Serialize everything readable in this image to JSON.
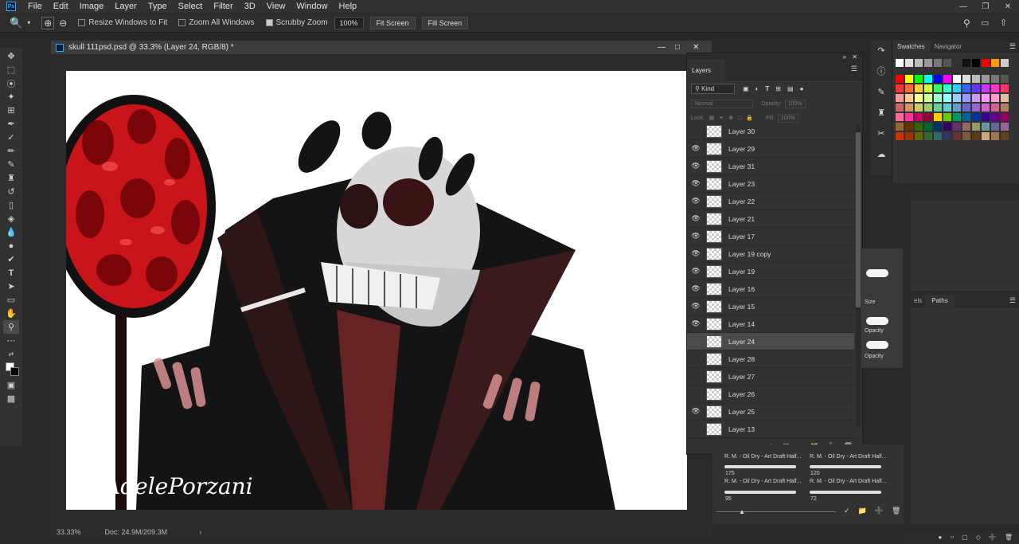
{
  "menubar": {
    "logo": "Ps",
    "items": [
      "File",
      "Edit",
      "Image",
      "Layer",
      "Type",
      "Select",
      "Filter",
      "3D",
      "View",
      "Window",
      "Help"
    ]
  },
  "options": {
    "resize_windows_label": "Resize Windows to Fit",
    "zoom_all_label": "Zoom All Windows",
    "scrubby_zoom_label": "Scrubby Zoom",
    "zoom_value": "100%",
    "fit_screen_label": "Fit Screen",
    "fill_screen_label": "Fill Screen"
  },
  "document": {
    "title": "skull 111psd.psd @ 33.3% (Layer 24, RGB/8) *",
    "zoom": "33.33%",
    "doc_size": "Doc: 24.9M/209.3M",
    "signature": "AdelePorzani"
  },
  "layers_panel": {
    "tab": "Layers",
    "kind_label": "Kind",
    "blend_mode": "Normal",
    "opacity_label": "Opacity:",
    "opacity_value": "100%",
    "lock_label": "Lock:",
    "fill_label": "Fill:",
    "fill_value": "100%",
    "layers": [
      {
        "name": "Layer 30",
        "visible": false,
        "selected": false
      },
      {
        "name": "Layer 29",
        "visible": true,
        "selected": false
      },
      {
        "name": "Layer 31",
        "visible": true,
        "selected": false
      },
      {
        "name": "Layer 23",
        "visible": true,
        "selected": false
      },
      {
        "name": "Layer 22",
        "visible": true,
        "selected": false
      },
      {
        "name": "Layer 21",
        "visible": true,
        "selected": false
      },
      {
        "name": "Layer 17",
        "visible": true,
        "selected": false
      },
      {
        "name": "Layer 19 copy",
        "visible": true,
        "selected": false
      },
      {
        "name": "Layer 19",
        "visible": true,
        "selected": false
      },
      {
        "name": "Layer 16",
        "visible": true,
        "selected": false
      },
      {
        "name": "Layer 15",
        "visible": true,
        "selected": false
      },
      {
        "name": "Layer 14",
        "visible": true,
        "selected": false
      },
      {
        "name": "Layer 24",
        "visible": false,
        "selected": true
      },
      {
        "name": "Layer 28",
        "visible": false,
        "selected": false
      },
      {
        "name": "Layer 27",
        "visible": false,
        "selected": false
      },
      {
        "name": "Layer 26",
        "visible": false,
        "selected": false
      },
      {
        "name": "Layer 25",
        "visible": true,
        "selected": false
      },
      {
        "name": "Layer 13",
        "visible": false,
        "selected": false
      }
    ]
  },
  "swatches_panel": {
    "tabs": [
      "Swatches",
      "Navigator"
    ],
    "grays": [
      "#ffffff",
      "#e0e0e0",
      "#bdbdbd",
      "#9a9a9a",
      "#777777",
      "#555555",
      "#333333",
      "#111111",
      "#000000",
      "#ff0000",
      "#ff9900",
      "#cccccc"
    ],
    "colors": [
      "#ff0000",
      "#ffff00",
      "#00ff00",
      "#00ffff",
      "#0000ff",
      "#ff00ff",
      "#ffffff",
      "#dddddd",
      "#bbbbbb",
      "#999999",
      "#777777",
      "#555555",
      "#ff3333",
      "#ff6633",
      "#ffcc33",
      "#ccff33",
      "#33ff66",
      "#33ffcc",
      "#33ccff",
      "#3366ff",
      "#6633ff",
      "#cc33ff",
      "#ff33cc",
      "#ff3366",
      "#ff9999",
      "#ffcc99",
      "#ffff99",
      "#ccff99",
      "#99ffcc",
      "#99ffff",
      "#99ccff",
      "#9999ff",
      "#cc99ff",
      "#ff99ff",
      "#ff99cc",
      "#e0c0a0",
      "#cc6666",
      "#cc9966",
      "#cccc66",
      "#99cc66",
      "#66cc99",
      "#66cccc",
      "#6699cc",
      "#6666cc",
      "#9966cc",
      "#cc66cc",
      "#cc6699",
      "#b08060",
      "#ff6699",
      "#ff3399",
      "#cc0066",
      "#990033",
      "#ffcc00",
      "#66cc00",
      "#009966",
      "#006699",
      "#003399",
      "#330099",
      "#660099",
      "#990066",
      "#996633",
      "#663300",
      "#336600",
      "#006633",
      "#003366",
      "#330066",
      "#663366",
      "#996666",
      "#999966",
      "#669999",
      "#666699",
      "#996699",
      "#cc3300",
      "#993300",
      "#666600",
      "#336633",
      "#336666",
      "#333366",
      "#663333",
      "#7a5a3a",
      "#5a3a1a",
      "#c8a878",
      "#a07850",
      "#604020"
    ]
  },
  "paths_panel": {
    "tabs": [
      "els",
      "Paths"
    ]
  },
  "brushes_panel": {
    "brush_label_a": "R. M. - Oil Dry - Art Draft Half...",
    "brush_label_b": "R. M. - Oil Dry - Art Draft Half...",
    "brush_label_c": "R. M. - Oil Dry - Art Draft Half...",
    "brush_label_d": "R. M. - Oil Dry - Art Draft Half...",
    "size_a": "175",
    "size_b": "120",
    "size_c": "95",
    "size_d": "72",
    "strip_labels": [
      "Size",
      "Opacity",
      "Opacity"
    ]
  }
}
